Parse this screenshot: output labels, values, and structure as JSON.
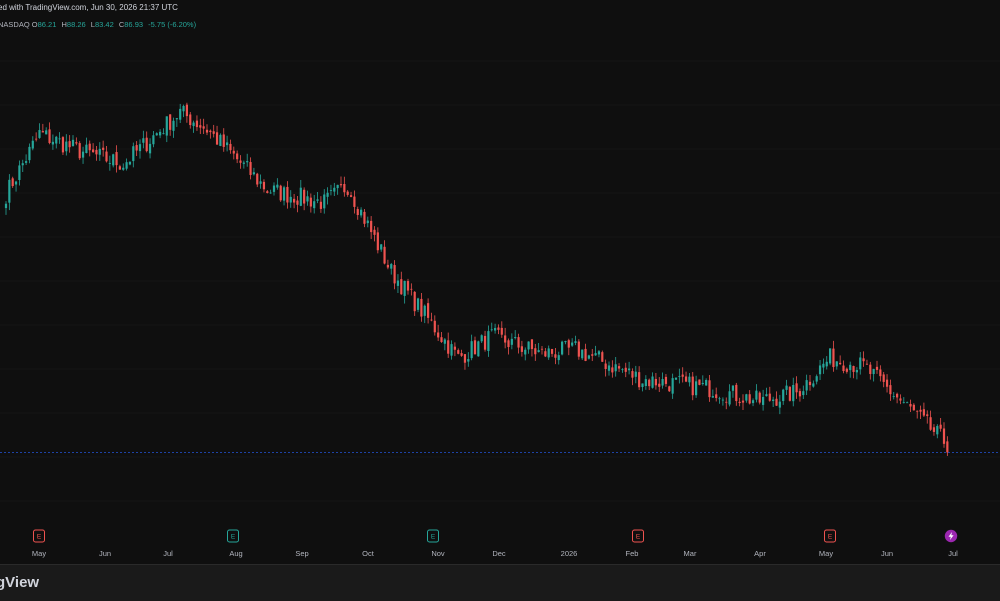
{
  "caption": "ed with TradingView.com, Jun 30, 2026 21:37 UTC",
  "legend": {
    "symbol": "NASDAQ",
    "o_label": "O",
    "o": "86.21",
    "h_label": "H",
    "h": "88.26",
    "l_label": "L",
    "l": "83.42",
    "c_label": "C",
    "c": "86.93",
    "change": "-5.75 (-6.20%)"
  },
  "brand": "gView",
  "colors": {
    "up": "#26a69a",
    "down": "#ef5350",
    "background": "#0f0f0f",
    "grid": "#1c1c1c",
    "text": "#b2b5be"
  },
  "chart_data": {
    "type": "candlestick",
    "x_axis_labels": [
      "May",
      "Jun",
      "Jul",
      "Aug",
      "Sep",
      "Oct",
      "Nov",
      "Dec",
      "2026",
      "Feb",
      "Mar",
      "Apr",
      "May",
      "Jun",
      "Jul"
    ],
    "events": [
      {
        "type": "earnings",
        "label": "E",
        "near": "May",
        "color": "down"
      },
      {
        "type": "earnings",
        "label": "E",
        "near": "Aug",
        "color": "up"
      },
      {
        "type": "earnings",
        "label": "E",
        "near": "Nov",
        "color": "up"
      },
      {
        "type": "earnings",
        "label": "E",
        "near": "Feb",
        "color": "down"
      },
      {
        "type": "earnings",
        "label": "E",
        "near": "May",
        "color": "down"
      },
      {
        "type": "upcoming",
        "label": "lightning",
        "near": "Jul",
        "color": "#9c27b0"
      }
    ],
    "trend_waypoints": [
      {
        "bar": 0,
        "close": 90
      },
      {
        "bar": 10,
        "close": 104
      },
      {
        "bar": 22,
        "close": 100
      },
      {
        "bar": 35,
        "close": 97
      },
      {
        "bar": 52,
        "close": 109
      },
      {
        "bar": 60,
        "close": 105
      },
      {
        "bar": 78,
        "close": 91
      },
      {
        "bar": 95,
        "close": 88
      },
      {
        "bar": 102,
        "close": 92
      },
      {
        "bar": 115,
        "close": 72
      },
      {
        "bar": 135,
        "close": 52
      },
      {
        "bar": 145,
        "close": 57
      },
      {
        "bar": 160,
        "close": 53
      },
      {
        "bar": 170,
        "close": 54
      },
      {
        "bar": 190,
        "close": 47
      },
      {
        "bar": 210,
        "close": 45
      },
      {
        "bar": 225,
        "close": 42
      },
      {
        "bar": 236,
        "close": 44
      },
      {
        "bar": 246,
        "close": 52
      },
      {
        "bar": 256,
        "close": 50
      },
      {
        "bar": 270,
        "close": 40
      },
      {
        "bar": 281,
        "close": 32
      }
    ],
    "last_bar": {
      "open": 86.21,
      "high": 88.26,
      "low": 83.42,
      "close": 86.93,
      "change": -5.75,
      "change_pct": -6.2
    },
    "grid": true,
    "price_scale": "hidden"
  }
}
